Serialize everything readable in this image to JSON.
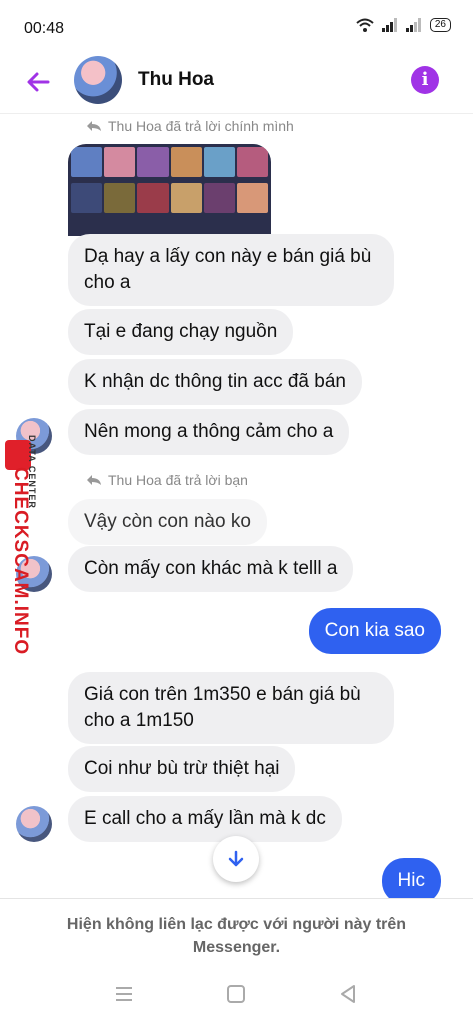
{
  "status": {
    "time": "00:48",
    "battery": "26"
  },
  "header": {
    "contact_name": "Thu Hoa"
  },
  "chat": {
    "reply_note_1": "Thu Hoa đã trả lời chính mình",
    "reply_note_2": "Thu Hoa đã trả lời bạn",
    "messages": [
      {
        "text": "Dạ hay a lấy con này e bán giá bù cho a"
      },
      {
        "text": "Tại e đang chạy nguồn"
      },
      {
        "text": "K nhận dc thông tin acc đã bán"
      },
      {
        "text": "Nên mong a thông cảm cho a"
      },
      {
        "text": "Vậy còn con nào ko"
      },
      {
        "text": "Còn mấy con khác mà k telll a"
      },
      {
        "text": "Con kia sao"
      },
      {
        "text": "Giá con trên 1m350 e bán giá bù cho a 1m150"
      },
      {
        "text": "Coi như bù trừ thiệt hại"
      },
      {
        "text": "E call cho a mấy lần mà k dc"
      },
      {
        "text": "Hic"
      }
    ]
  },
  "watermark": {
    "brand": "CHECKSCAM.INFO",
    "sub": "DATA CENTER"
  },
  "footer": {
    "notice": "Hiện không liên lạc được với người này trên Messenger."
  },
  "colors": {
    "accent": "#a033e6",
    "my_bubble": "#2f61f0",
    "their_bubble": "#efeff1"
  },
  "icons": [
    "back-arrow-icon",
    "info-icon",
    "wifi-icon",
    "signal-icon",
    "reply-icon",
    "scroll-down-icon",
    "menu-nav-icon",
    "home-nav-icon",
    "back-nav-icon"
  ]
}
